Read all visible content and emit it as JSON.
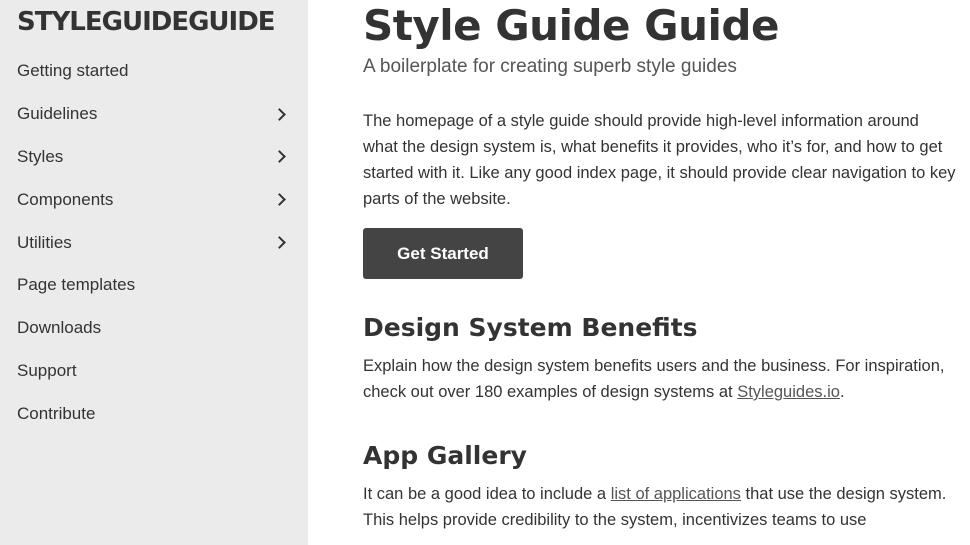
{
  "logo": "STYLEGUIDEGUIDE",
  "sidebar": {
    "items": [
      {
        "label": "Getting started",
        "has_submenu": false
      },
      {
        "label": "Guidelines",
        "has_submenu": true
      },
      {
        "label": "Styles",
        "has_submenu": true
      },
      {
        "label": "Components",
        "has_submenu": true
      },
      {
        "label": "Utilities",
        "has_submenu": true
      },
      {
        "label": "Page templates",
        "has_submenu": false
      },
      {
        "label": "Downloads",
        "has_submenu": false
      },
      {
        "label": "Support",
        "has_submenu": false
      },
      {
        "label": "Contribute",
        "has_submenu": false
      }
    ]
  },
  "main": {
    "title": "Style Guide Guide",
    "subtitle": "A boilerplate for creating superb style guides",
    "intro": "The homepage of a style guide should provide high-level information around what the design system is, what benefits it provides, who it’s for, and how to get started with it. Like any good index page, it should provide clear navigation to key parts of the website.",
    "cta_label": "Get Started",
    "benefits": {
      "heading": "Design System Benefits",
      "text_before": "Explain how the design system benefits users and the business. For inspiration, check out over 180 examples of design systems at ",
      "link": "Styleguides.io",
      "text_after": "."
    },
    "gallery": {
      "heading": "App Gallery",
      "text_before": "It can be a good idea to include a ",
      "link": "list of applications",
      "text_after": " that use the design system. This helps provide credibility to the system, incentivizes teams to use"
    }
  },
  "colors": {
    "sidebar_bg": "#ebebeb",
    "button_bg": "#444444",
    "text": "#333333"
  }
}
